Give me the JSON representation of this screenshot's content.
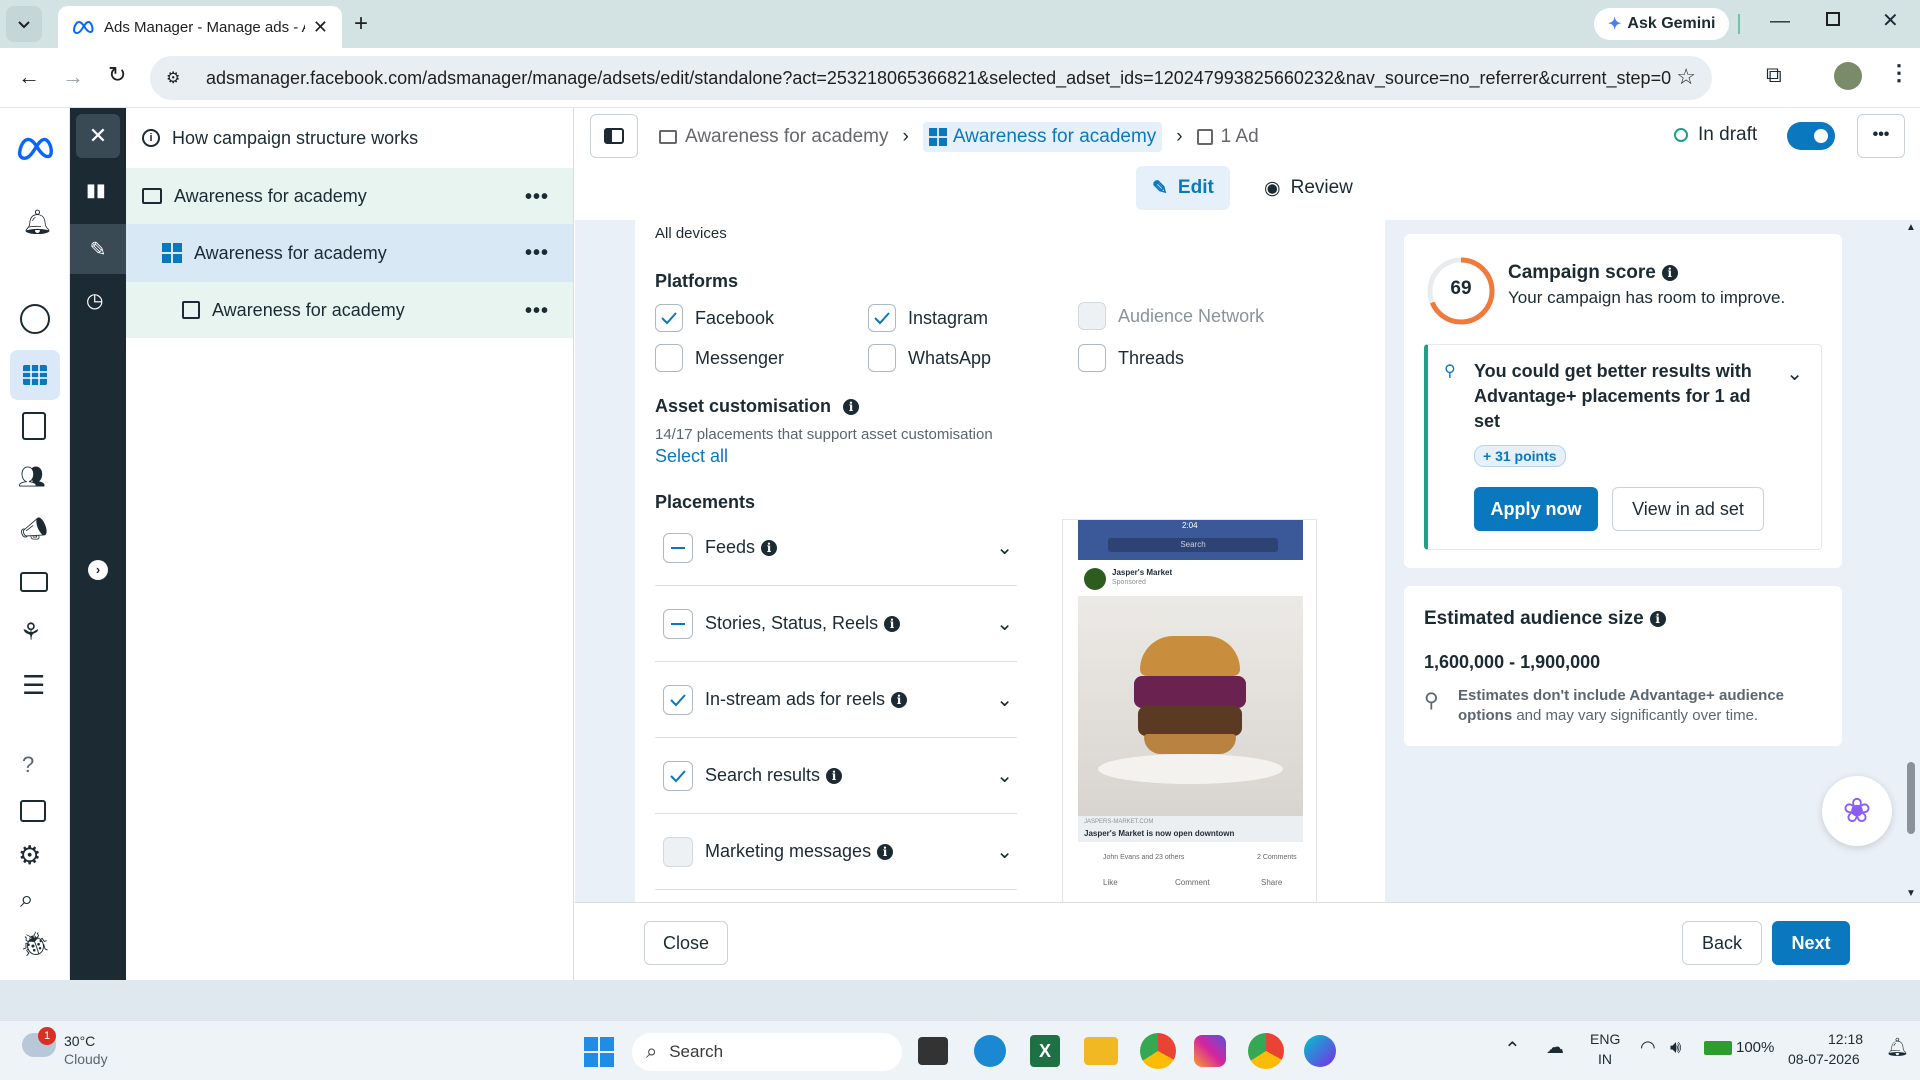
{
  "browser": {
    "tab_title": "Ads Manager - Manage ads - A",
    "gemini_label": "Ask Gemini",
    "url": "adsmanager.facebook.com/adsmanager/manage/adsets/edit/standalone?act=253218065366821&selected_adset_ids=120247993825660232&nav_source=no_referrer&current_step=0"
  },
  "tree": {
    "help_link": "How campaign structure works",
    "items": [
      {
        "label": "Awareness for academy"
      },
      {
        "label": "Awareness for academy"
      },
      {
        "label": "Awareness for academy"
      }
    ]
  },
  "breadcrumb": {
    "campaign": "Awareness for academy",
    "adset": "Awareness for academy",
    "ad": "1 Ad",
    "status": "In draft"
  },
  "mode_tabs": {
    "edit": "Edit",
    "review": "Review"
  },
  "form": {
    "devices": "All devices",
    "platforms_title": "Platforms",
    "platforms": [
      {
        "label": "Facebook",
        "checked": true
      },
      {
        "label": "Instagram",
        "checked": true
      },
      {
        "label": "Audience Network",
        "checked": false,
        "disabled": true
      },
      {
        "label": "Messenger",
        "checked": false
      },
      {
        "label": "WhatsApp",
        "checked": false
      },
      {
        "label": "Threads",
        "checked": false
      }
    ],
    "asset_title": "Asset customisation",
    "asset_sub": "14/17 placements that support asset customisation",
    "select_all": "Select all",
    "placements_title": "Placements",
    "placements": [
      {
        "label": "Feeds",
        "state": "partial"
      },
      {
        "label": "Stories, Status, Reels",
        "state": "partial"
      },
      {
        "label": "In-stream ads for reels",
        "state": "checked"
      },
      {
        "label": "Search results",
        "state": "checked"
      },
      {
        "label": "Marketing messages",
        "state": "empty"
      }
    ]
  },
  "preview": {
    "time": "2:04",
    "search": "Search",
    "page_name": "Jasper's Market",
    "sponsored": "Sponsored",
    "link_domain": "JASPERS-MARKET.COM",
    "headline": "Jasper's Market is now open downtown",
    "reactions": "John Evans and 23 others",
    "comments_count": "2 Comments",
    "like": "Like",
    "comment": "Comment",
    "share": "Share"
  },
  "score": {
    "value": "69",
    "title": "Campaign score",
    "sub": "Your campaign has room to improve.",
    "rec_title": "You could get better results with Advantage+ placements for 1 ad set",
    "points": "+ 31 points",
    "apply": "Apply now",
    "view": "View in ad set"
  },
  "audience": {
    "title": "Estimated audience size",
    "range": "1,600,000 - 1,900,000",
    "note_bold": "Estimates don't include Advantage+ audience options",
    "note_rest": " and may vary significantly over time."
  },
  "footer": {
    "close": "Close",
    "back": "Back",
    "next": "Next"
  },
  "taskbar": {
    "weather_temp": "30°C",
    "weather_desc": "Cloudy",
    "weather_badge": "1",
    "search": "Search",
    "lang1": "ENG",
    "lang2": "IN",
    "battery": "100%",
    "time": "12:18",
    "date": "08-07-2026"
  },
  "colors": {
    "accent": "#0a78be",
    "dark_nav": "#1c2b33",
    "score_ring": "#f0793b",
    "rec_bar": "#1f9e8a"
  }
}
